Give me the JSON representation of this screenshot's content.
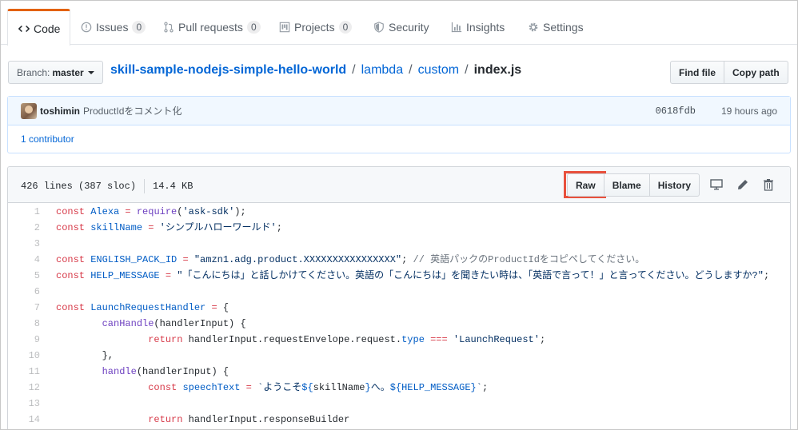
{
  "tabs": [
    {
      "label": "Code",
      "icon": "code-icon",
      "selected": true
    },
    {
      "label": "Issues",
      "icon": "issue-opened-icon",
      "count": "0"
    },
    {
      "label": "Pull requests",
      "icon": "git-pull-request-icon",
      "count": "0"
    },
    {
      "label": "Projects",
      "icon": "project-icon",
      "count": "0"
    },
    {
      "label": "Security",
      "icon": "shield-icon"
    },
    {
      "label": "Insights",
      "icon": "graph-icon"
    },
    {
      "label": "Settings",
      "icon": "gear-icon"
    }
  ],
  "branch": {
    "label": "Branch:",
    "value": "master"
  },
  "breadcrumb": {
    "repo": "skill-sample-nodejs-simple-hello-world",
    "sep": "/",
    "dir1": "lambda",
    "dir2": "custom",
    "file": "index.js"
  },
  "path_actions": {
    "find_file": "Find file",
    "copy_path": "Copy path"
  },
  "commit": {
    "author": "toshimin",
    "message": "ProductIdをコメント化",
    "sha": "0618fdb",
    "time": "19 hours ago",
    "contributors": "1 contributor"
  },
  "file": {
    "lines": "426 lines (387 sloc)",
    "size": "14.4 KB",
    "raw": "Raw",
    "blame": "Blame",
    "history": "History"
  },
  "colors": {
    "keyword": "#d73a49",
    "entity": "#6f42c1",
    "constant": "#005cc5",
    "string": "#032f62",
    "comment": "#6a737d",
    "plain": "#24292e",
    "highlight": "#e8503c",
    "link": "#0366d6"
  },
  "code_lines": [
    {
      "n": "1",
      "tokens": [
        [
          "k",
          "const "
        ],
        [
          "c",
          "Alexa"
        ],
        [
          "k",
          " = "
        ],
        [
          "e",
          "require"
        ],
        [
          "p",
          "("
        ],
        [
          "s",
          "'ask-sdk'"
        ],
        [
          "p",
          ");"
        ]
      ]
    },
    {
      "n": "2",
      "tokens": [
        [
          "k",
          "const "
        ],
        [
          "c",
          "skillName"
        ],
        [
          "k",
          " = "
        ],
        [
          "s",
          "'シンプルハローワールド'"
        ],
        [
          "p",
          ";"
        ]
      ]
    },
    {
      "n": "3",
      "tokens": []
    },
    {
      "n": "4",
      "tokens": [
        [
          "k",
          "const "
        ],
        [
          "c",
          "ENGLISH_PACK_ID"
        ],
        [
          "k",
          " = "
        ],
        [
          "s",
          "\"amzn1.adg.product.XXXXXXXXXXXXXXXX\""
        ],
        [
          "p",
          "; "
        ],
        [
          "m",
          "// 英語パックのProductIdをコピペしてください。"
        ]
      ]
    },
    {
      "n": "5",
      "tokens": [
        [
          "k",
          "const "
        ],
        [
          "c",
          "HELP_MESSAGE"
        ],
        [
          "k",
          " = "
        ],
        [
          "s",
          "\"「こんにちは」と話しかけてください。英語の「こんにちは」を聞きたい時は、「英語で言って！」と言ってください。どうしますか?\""
        ],
        [
          "p",
          ";"
        ]
      ]
    },
    {
      "n": "6",
      "tokens": []
    },
    {
      "n": "7",
      "tokens": [
        [
          "k",
          "const "
        ],
        [
          "c",
          "LaunchRequestHandler"
        ],
        [
          "k",
          " = "
        ],
        [
          "p",
          "{"
        ]
      ]
    },
    {
      "n": "8",
      "tokens": [
        [
          "p",
          "        "
        ],
        [
          "e",
          "canHandle"
        ],
        [
          "p",
          "(handlerInput) {"
        ]
      ]
    },
    {
      "n": "9",
      "tokens": [
        [
          "p",
          "                "
        ],
        [
          "k",
          "return "
        ],
        [
          "p",
          "handlerInput.requestEnvelope.request."
        ],
        [
          "c",
          "type"
        ],
        [
          "k",
          " === "
        ],
        [
          "s",
          "'LaunchRequest'"
        ],
        [
          "p",
          ";"
        ]
      ]
    },
    {
      "n": "10",
      "tokens": [
        [
          "p",
          "        },"
        ]
      ]
    },
    {
      "n": "11",
      "tokens": [
        [
          "p",
          "        "
        ],
        [
          "e",
          "handle"
        ],
        [
          "p",
          "(handlerInput) {"
        ]
      ]
    },
    {
      "n": "12",
      "tokens": [
        [
          "p",
          "                "
        ],
        [
          "k",
          "const "
        ],
        [
          "c",
          "speechText"
        ],
        [
          "k",
          " = "
        ],
        [
          "s",
          "`ようこそ"
        ],
        [
          "c",
          "${"
        ],
        [
          "p",
          "skillName"
        ],
        [
          "c",
          "}"
        ],
        [
          "s",
          "へ。"
        ],
        [
          "c",
          "${"
        ],
        [
          "c",
          "HELP_MESSAGE"
        ],
        [
          "c",
          "}"
        ],
        [
          "s",
          "`"
        ],
        [
          "p",
          ";"
        ]
      ]
    },
    {
      "n": "13",
      "tokens": []
    },
    {
      "n": "14",
      "tokens": [
        [
          "p",
          "                "
        ],
        [
          "k",
          "return "
        ],
        [
          "p",
          "handlerInput.responseBuilder"
        ]
      ]
    }
  ]
}
